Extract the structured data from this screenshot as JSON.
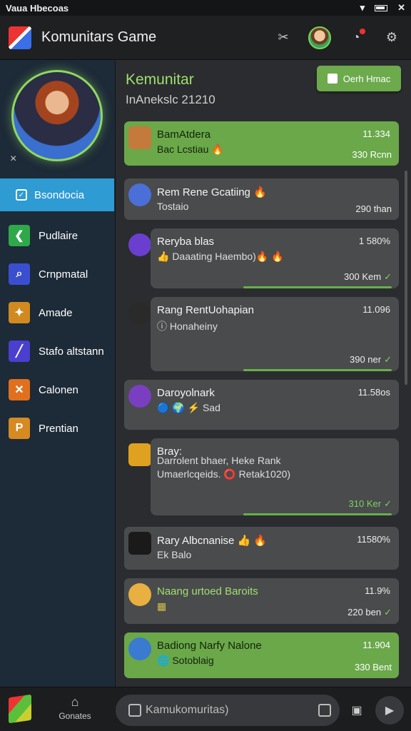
{
  "status_bar": {
    "carrier": "Vaua Hbecoas",
    "close": "✕"
  },
  "header": {
    "title": "Komunitars Game"
  },
  "sidebar": {
    "close": "×",
    "active_item": {
      "label": "Bsondocia",
      "icon": "check-square-icon"
    },
    "items": [
      {
        "label": "Pudlaire",
        "icon": "arrow-icon",
        "color": "#2fa84a"
      },
      {
        "label": "Crnpmatal",
        "icon": "magnifier-icon",
        "color": "#3a4fd0"
      },
      {
        "label": "Amade",
        "icon": "flame-icon",
        "color": "#d08a20"
      },
      {
        "label": "Stafo altstann",
        "icon": "sword-icon",
        "color": "#4a3fcf"
      },
      {
        "label": "Calonen",
        "icon": "cross-swords-icon",
        "color": "#e0701e"
      },
      {
        "label": "Prentian",
        "icon": "badge-icon",
        "color": "#d58a22"
      }
    ]
  },
  "main": {
    "title": "Kemunitar",
    "subtitle": "InAnekslc 21210",
    "open_button": "Oerh Hmac",
    "cards": [
      {
        "name": "BamAtdera",
        "message": "Bac Lcstiau 🔥",
        "time": "11.334",
        "footer": "330 Rcnn",
        "variant": "green",
        "avatar": "#c47a3a"
      },
      {
        "name": "Rem Rene Gcatiing 🔥",
        "message": "Tostaio",
        "time": "",
        "footer": "290 than",
        "variant": "gray",
        "avatar": "#4a6fd8"
      },
      {
        "name": "Reryba blas",
        "message": "👍 Daaating Haembo)🔥 🔥",
        "time": "1 580%",
        "footer": "300 Kem",
        "variant": "bubble",
        "avatar": "#6a3fcf"
      },
      {
        "name": "Rang RentUohapian",
        "message": "ⓘ Honaheiny",
        "time": "11.096",
        "footer": "390 ner",
        "variant": "bubble",
        "avatar": "#2a2a2a"
      },
      {
        "name": "Daroyolnark",
        "message": "🔵 🌍 ⚡ Sad",
        "time": "11.58os",
        "footer": "",
        "variant": "gray",
        "avatar": "#7a3fc0"
      },
      {
        "name": "Bray:",
        "message": "Darrolent bhaer, Heke Rank",
        "message2": "Umaerlcqeids. ⭕ Retak1020)",
        "time": "",
        "footer": "310 Ker",
        "variant": "bubble",
        "avatar": "#e0a020"
      },
      {
        "name": "Rary Albcnanise 👍 🔥",
        "message": "Ek Balo",
        "time": "11580%",
        "footer": "",
        "variant": "gray",
        "avatar": "#1a1a1a"
      },
      {
        "name": "Naang urtoed Baroits",
        "message": "▦",
        "time": "11.9%",
        "footer": "220 ben",
        "variant": "gray",
        "avatar": "#e8b040"
      },
      {
        "name": "Badiong Narfy Nalone",
        "message": "🌐 Sotoblaig",
        "time": "11.904",
        "footer": "330 Bent",
        "variant": "green",
        "avatar": "#3a7ad0"
      }
    ]
  },
  "bottom_bar": {
    "home_label": "Gonates",
    "composer_placeholder": "Kamukomuritas)"
  }
}
